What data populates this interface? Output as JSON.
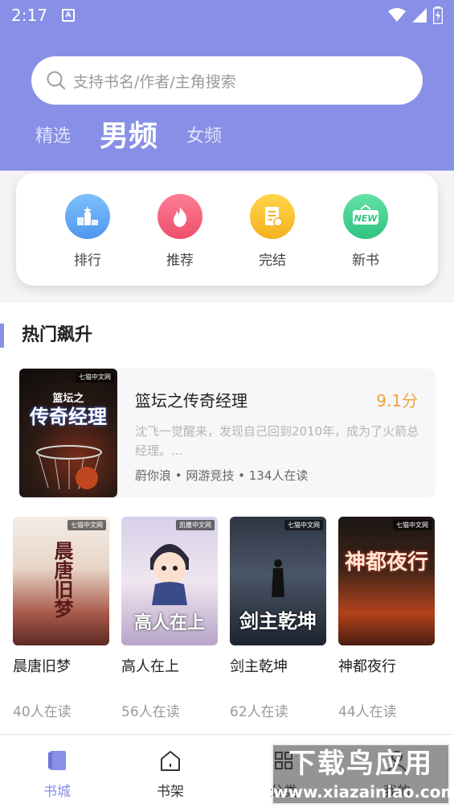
{
  "status": {
    "time": "2:17",
    "note_glyph": "A"
  },
  "search": {
    "placeholder": "支持书名/作者/主角搜索"
  },
  "tabs": [
    {
      "label": "精选",
      "active": false
    },
    {
      "label": "男频",
      "active": true
    },
    {
      "label": "女频",
      "active": false
    }
  ],
  "categories": [
    {
      "label": "排行",
      "icon": "ranking-icon",
      "color": "#5aa8f5"
    },
    {
      "label": "推荐",
      "icon": "fire-icon",
      "color": "#f45b7a"
    },
    {
      "label": "完结",
      "icon": "document-icon",
      "color": "#f7c12e"
    },
    {
      "label": "新书",
      "icon": "new-icon",
      "color": "#3ed18f"
    }
  ],
  "section": {
    "title": "热门飙升"
  },
  "featured": {
    "title": "篮坛之传奇经理",
    "score": "9.1分",
    "description": "沈飞一觉醒来，发现自己回到2010年，成为了火箭总经理。...",
    "meta": "蔚你浪 • 网游竞技 • 134人在读",
    "cover_text": "传奇经理",
    "cover_sub": "篮坛之",
    "publisher": "七猫中文网"
  },
  "books": [
    {
      "title": "晨唐旧梦",
      "readers": "40人在读",
      "cover_text": "晨唐旧梦",
      "publisher": "七猫中文网"
    },
    {
      "title": "高人在上",
      "readers": "56人在读",
      "cover_text": "高人在上",
      "publisher": "凯撒中文网"
    },
    {
      "title": "剑主乾坤",
      "readers": "62人在读",
      "cover_text": "剑主乾坤",
      "publisher": "七猫中文网"
    },
    {
      "title": "神都夜行",
      "readers": "44人在读",
      "cover_text": "神都夜行",
      "publisher": "七猫中文网"
    }
  ],
  "nav": [
    {
      "label": "书城",
      "icon": "bookstore-icon",
      "active": true
    },
    {
      "label": "书架",
      "icon": "bookshelf-icon",
      "active": false
    },
    {
      "label": "分类",
      "icon": "category-icon",
      "active": false
    },
    {
      "label": "我的",
      "icon": "profile-icon",
      "active": false
    }
  ],
  "watermark": {
    "line1": "下载鸟应用",
    "line2": "www.xiazainiao.com"
  },
  "colors": {
    "accent": "#8790e6",
    "score": "#f0a33c"
  }
}
